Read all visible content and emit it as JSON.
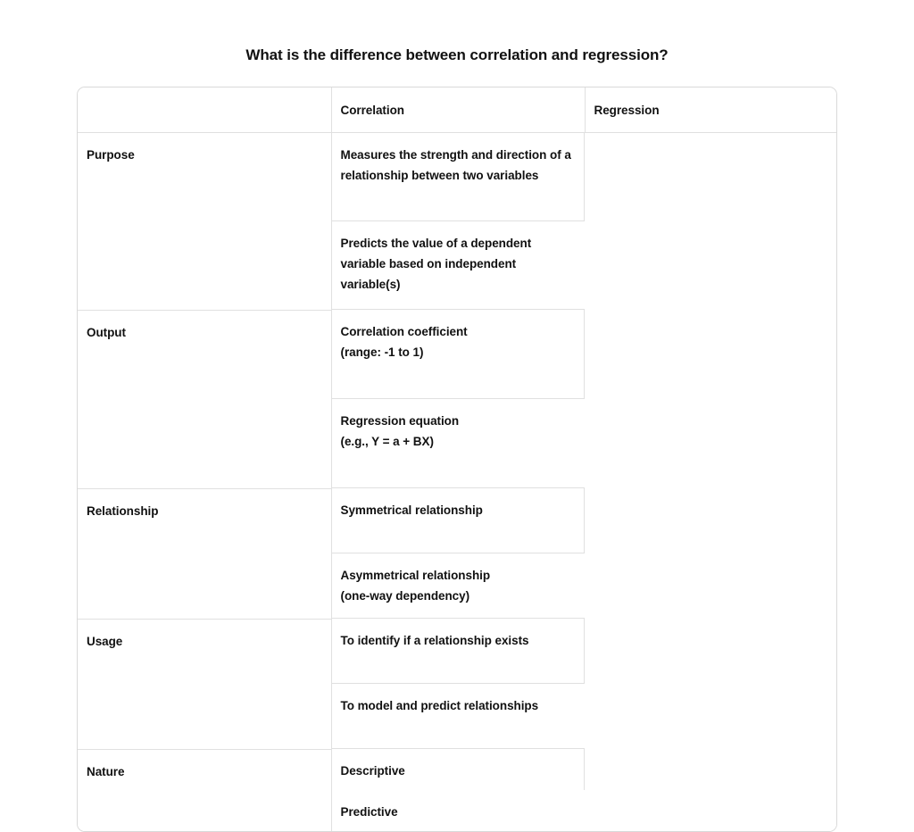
{
  "page": {
    "title": "What is the difference between correlation and regression?",
    "background_color": "#ffffff",
    "text_color": "#111111",
    "border_color": "#d9d9d9"
  },
  "table": {
    "corner_label": "",
    "columns": [
      "",
      "Correlation",
      "Regression"
    ],
    "rows": [
      {
        "label": "Purpose",
        "correlation": "Measures the strength and direction of a relationship between two variables",
        "regression": "Predicts the value of a dependent variable based on independent variable(s)"
      },
      {
        "label": "Output",
        "correlation": "Correlation coefficient\n(range: -1 to 1)",
        "regression": "Regression equation\n(e.g., Y = a + BX)"
      },
      {
        "label": "Relationship",
        "correlation": "Symmetrical relationship",
        "regression": "Asymmetrical relationship\n(one-way dependency)"
      },
      {
        "label": "Usage",
        "correlation": "To identify if a relationship exists",
        "regression": "To model and predict relationships"
      },
      {
        "label": "Nature",
        "correlation": "Descriptive",
        "regression": "Predictive"
      }
    ]
  }
}
